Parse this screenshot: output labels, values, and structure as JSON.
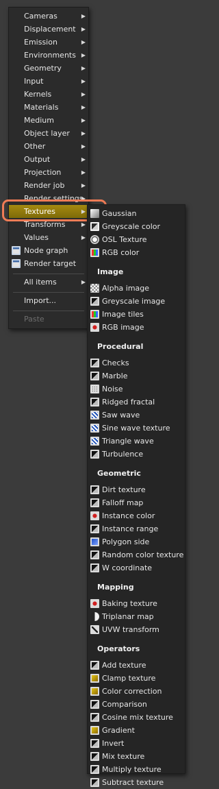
{
  "main_menu": {
    "items": [
      {
        "label": "Cameras",
        "arrow": true
      },
      {
        "label": "Displacement",
        "arrow": true
      },
      {
        "label": "Emission",
        "arrow": true
      },
      {
        "label": "Environments",
        "arrow": true
      },
      {
        "label": "Geometry",
        "arrow": true
      },
      {
        "label": "Input",
        "arrow": true
      },
      {
        "label": "Kernels",
        "arrow": true
      },
      {
        "label": "Materials",
        "arrow": true
      },
      {
        "label": "Medium",
        "arrow": true
      },
      {
        "label": "Object layer",
        "arrow": true
      },
      {
        "label": "Other",
        "arrow": true
      },
      {
        "label": "Output",
        "arrow": true
      },
      {
        "label": "Projection",
        "arrow": true
      },
      {
        "label": "Render job",
        "arrow": true
      },
      {
        "label": "Render settings",
        "arrow": true
      },
      {
        "label": "Textures",
        "arrow": true,
        "highlighted": true
      },
      {
        "label": "Transforms",
        "arrow": true
      },
      {
        "label": "Values",
        "arrow": true
      }
    ],
    "node_graph": "Node graph",
    "render_target": "Render target",
    "all_items": "All items",
    "import": "Import...",
    "paste": "Paste"
  },
  "sub_menu": {
    "top_items": [
      {
        "label": "Gaussian",
        "icon": "gaussian-icon"
      },
      {
        "label": "Greyscale color",
        "icon": "greyscale-color-icon"
      },
      {
        "label": "OSL Texture",
        "icon": "osl-texture-icon"
      },
      {
        "label": "RGB color",
        "icon": "rgb-color-icon"
      }
    ],
    "sections": [
      {
        "header": "Image",
        "items": [
          {
            "label": "Alpha image",
            "icon": "alpha-image-icon"
          },
          {
            "label": "Greyscale image",
            "icon": "greyscale-image-icon"
          },
          {
            "label": "Image tiles",
            "icon": "image-tiles-icon"
          },
          {
            "label": "RGB image",
            "icon": "rgb-image-icon"
          }
        ]
      },
      {
        "header": "Procedural",
        "items": [
          {
            "label": "Checks",
            "icon": "checks-icon"
          },
          {
            "label": "Marble",
            "icon": "marble-icon"
          },
          {
            "label": "Noise",
            "icon": "noise-icon"
          },
          {
            "label": "Ridged fractal",
            "icon": "ridged-fractal-icon"
          },
          {
            "label": "Saw wave",
            "icon": "saw-wave-icon"
          },
          {
            "label": "Sine wave texture",
            "icon": "sine-wave-icon"
          },
          {
            "label": "Triangle wave",
            "icon": "triangle-wave-icon"
          },
          {
            "label": "Turbulence",
            "icon": "turbulence-icon"
          }
        ]
      },
      {
        "header": "Geometric",
        "items": [
          {
            "label": "Dirt texture",
            "icon": "dirt-texture-icon"
          },
          {
            "label": "Falloff map",
            "icon": "falloff-map-icon"
          },
          {
            "label": "Instance color",
            "icon": "instance-color-icon"
          },
          {
            "label": "Instance range",
            "icon": "instance-range-icon"
          },
          {
            "label": "Polygon side",
            "icon": "polygon-side-icon"
          },
          {
            "label": "Random color texture",
            "icon": "random-color-icon"
          },
          {
            "label": "W coordinate",
            "icon": "w-coordinate-icon"
          }
        ]
      },
      {
        "header": "Mapping",
        "items": [
          {
            "label": "Baking texture",
            "icon": "baking-texture-icon"
          },
          {
            "label": "Triplanar map",
            "icon": "triplanar-map-icon"
          },
          {
            "label": "UVW transform",
            "icon": "uvw-transform-icon"
          }
        ]
      },
      {
        "header": "Operators",
        "items": [
          {
            "label": "Add texture",
            "icon": "add-texture-icon"
          },
          {
            "label": "Clamp texture",
            "icon": "clamp-texture-icon"
          },
          {
            "label": "Color correction",
            "icon": "color-correction-icon"
          },
          {
            "label": "Comparison",
            "icon": "comparison-icon"
          },
          {
            "label": "Cosine mix texture",
            "icon": "cosine-mix-icon"
          },
          {
            "label": "Gradient",
            "icon": "gradient-icon"
          },
          {
            "label": "Invert",
            "icon": "invert-icon"
          },
          {
            "label": "Mix texture",
            "icon": "mix-texture-icon"
          },
          {
            "label": "Multiply texture",
            "icon": "multiply-texture-icon"
          },
          {
            "label": "Subtract texture",
            "icon": "subtract-texture-icon"
          }
        ]
      }
    ]
  },
  "colors": {
    "highlight": "#9a800d",
    "annotation_ring": "#f07c56",
    "menu_bg": "#2b2b2b"
  }
}
